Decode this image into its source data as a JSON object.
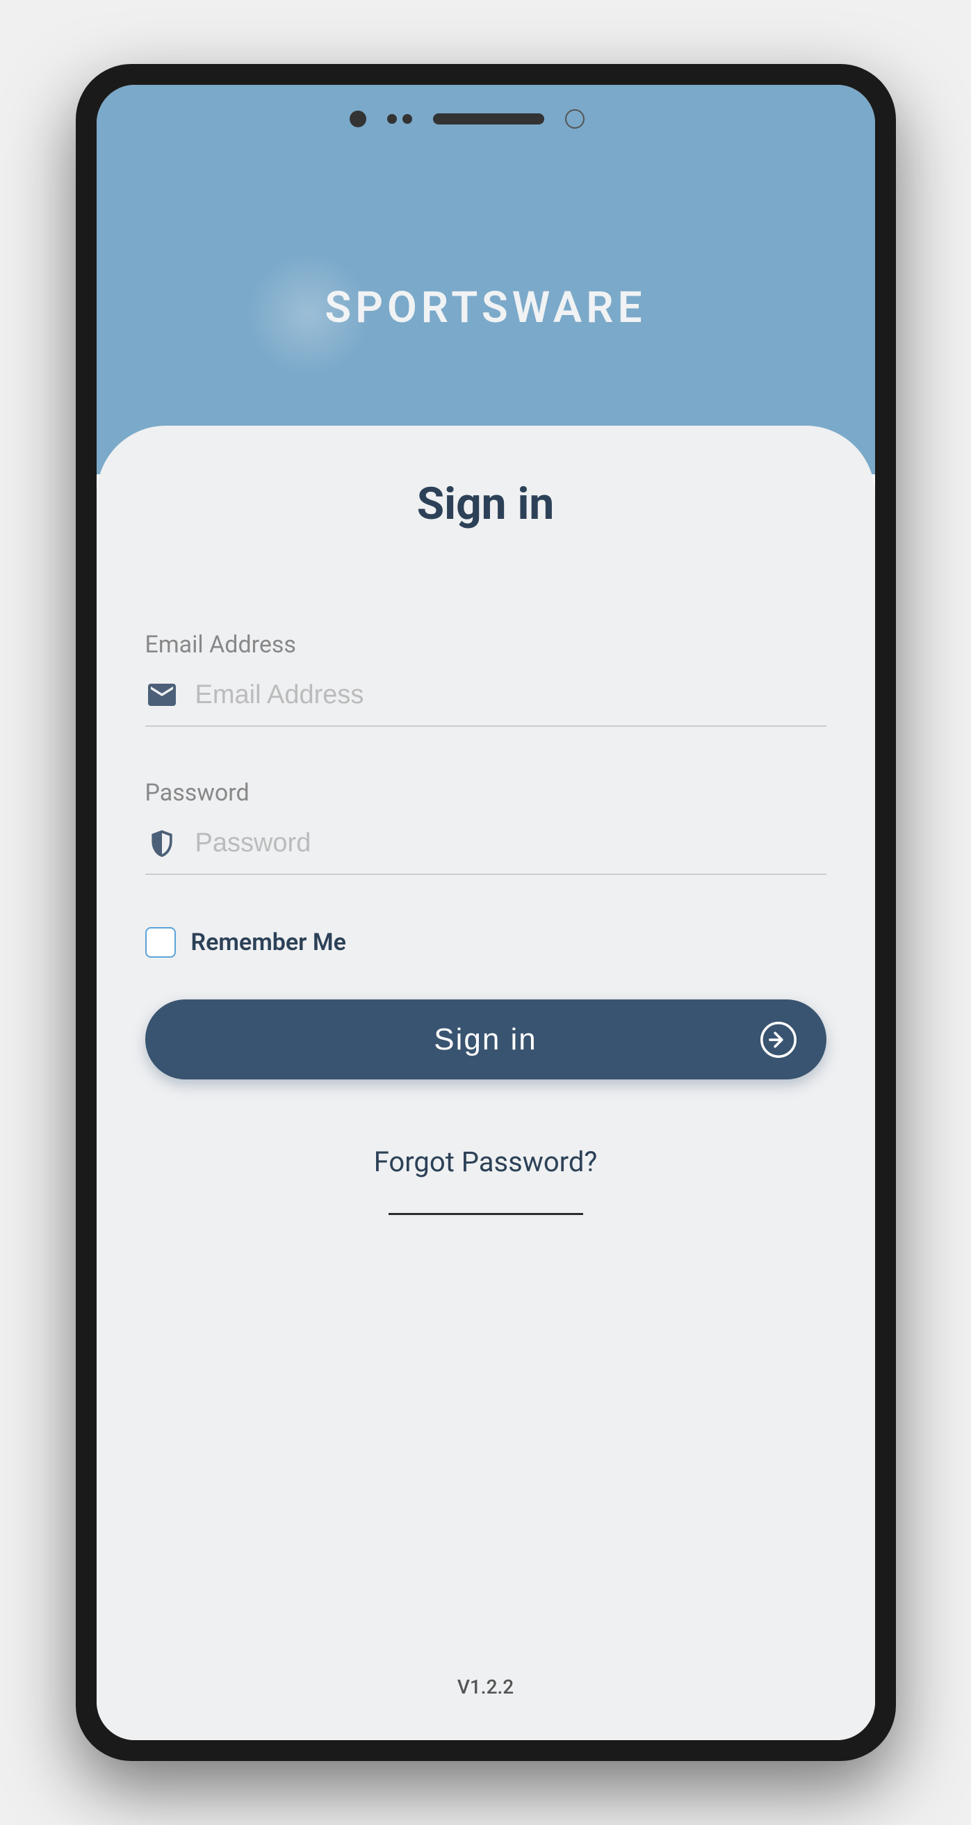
{
  "header": {
    "logo_text": "SPORTSWARE"
  },
  "signin": {
    "title": "Sign in",
    "email_label": "Email Address",
    "email_placeholder": "Email Address",
    "password_label": "Password",
    "password_placeholder": "Password",
    "remember_label": "Remember Me",
    "button_label": "Sign in",
    "forgot_label": "Forgot Password?"
  },
  "footer": {
    "version": "V1.2.2"
  },
  "colors": {
    "header_bg": "#7ba9c9",
    "primary": "#395470",
    "accent": "#5ba3d9",
    "text_dark": "#2c4157"
  }
}
